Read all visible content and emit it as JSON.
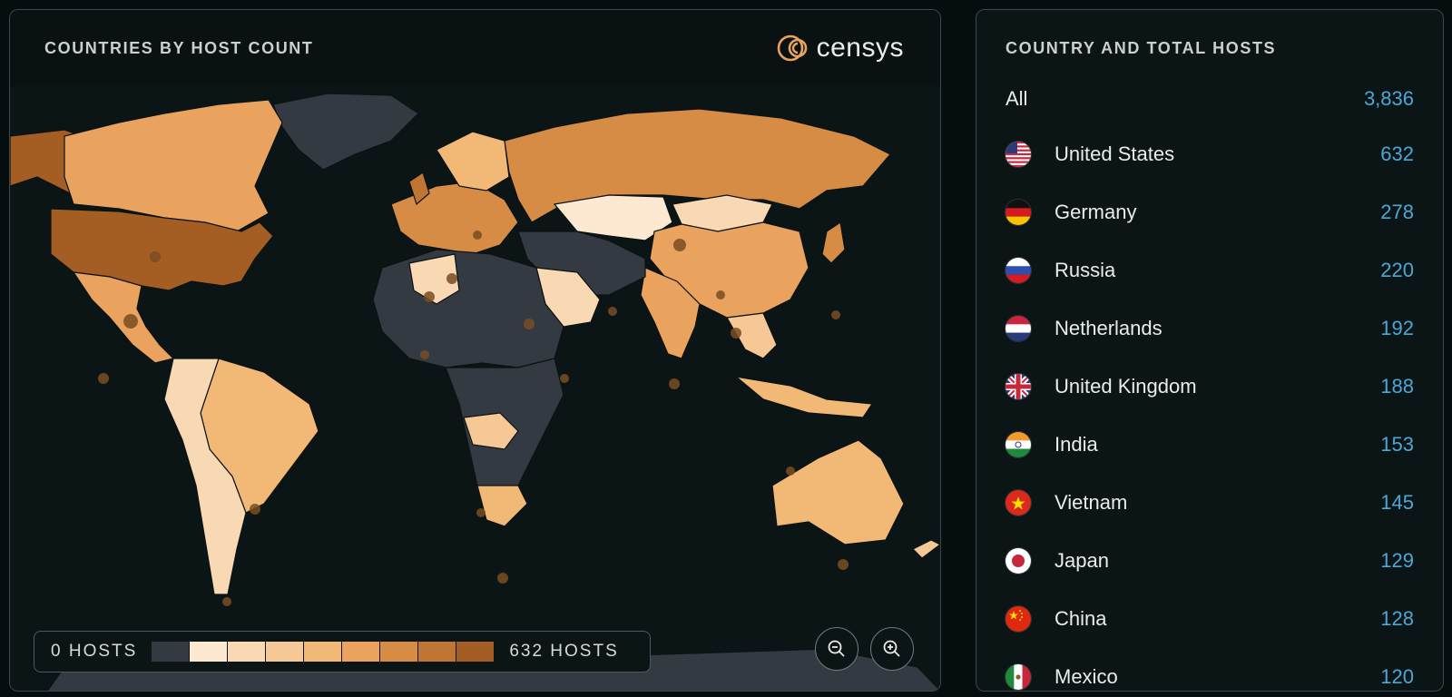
{
  "map_panel": {
    "title": "COUNTRIES BY HOST COUNT",
    "logo_text": "censys",
    "legend": {
      "min_label": "0 HOSTS",
      "max_label": "632 HOSTS",
      "colors": [
        "#343a42",
        "#fde9d2",
        "#f9d9b4",
        "#f5c896",
        "#f1b876",
        "#e9a35e",
        "#d68c44",
        "#bf7533",
        "#a45e24"
      ]
    },
    "zoom_out_icon": "zoom-out-icon",
    "zoom_in_icon": "zoom-in-icon"
  },
  "list_panel": {
    "title": "COUNTRY AND TOTAL HOSTS",
    "all_label": "All",
    "all_count": "3,836",
    "rows": [
      {
        "country": "United States",
        "count": "632",
        "flag": "us-flag-icon"
      },
      {
        "country": "Germany",
        "count": "278",
        "flag": "de-flag-icon"
      },
      {
        "country": "Russia",
        "count": "220",
        "flag": "ru-flag-icon"
      },
      {
        "country": "Netherlands",
        "count": "192",
        "flag": "nl-flag-icon"
      },
      {
        "country": "United Kingdom",
        "count": "188",
        "flag": "gb-flag-icon"
      },
      {
        "country": "India",
        "count": "153",
        "flag": "in-flag-icon"
      },
      {
        "country": "Vietnam",
        "count": "145",
        "flag": "vn-flag-icon"
      },
      {
        "country": "Japan",
        "count": "129",
        "flag": "jp-flag-icon"
      },
      {
        "country": "China",
        "count": "128",
        "flag": "cn-flag-icon"
      },
      {
        "country": "Mexico",
        "count": "120",
        "flag": "mx-flag-icon"
      }
    ]
  },
  "colors": {
    "accent_count": "#4aa8d8",
    "no_hosts": "#343a42",
    "max_hosts": "#a45e24"
  }
}
